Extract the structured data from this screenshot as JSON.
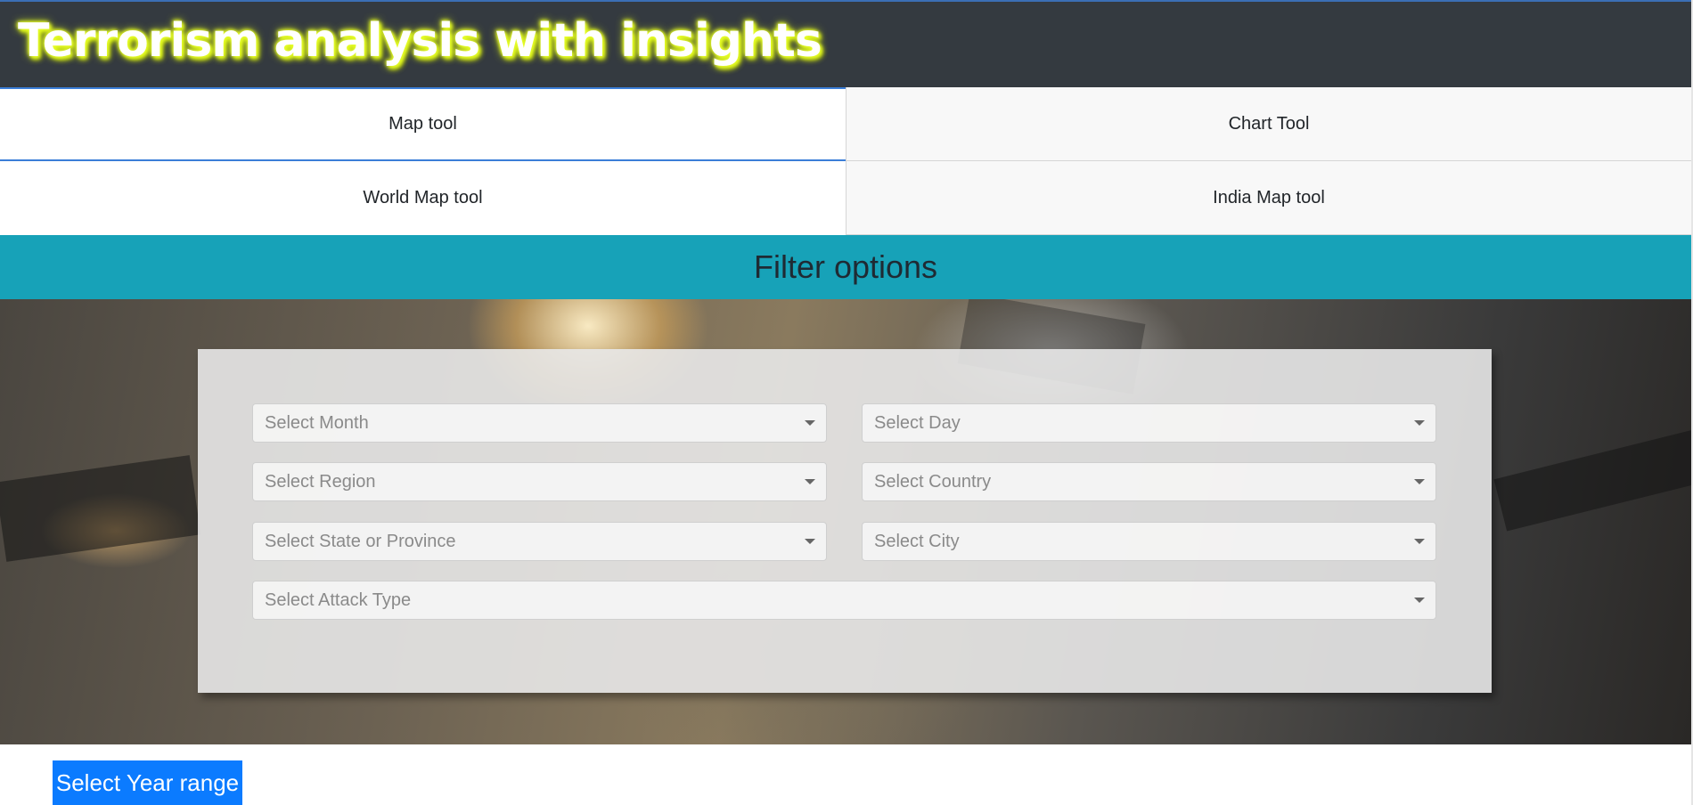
{
  "header": {
    "title": "Terrorism analysis with insights"
  },
  "tabs": [
    {
      "label": "Map tool",
      "state": "active"
    },
    {
      "label": "Chart Tool",
      "state": "inactive"
    },
    {
      "label": "World Map tool",
      "state": "active-subtab"
    },
    {
      "label": "India Map tool",
      "state": "inactive"
    }
  ],
  "filter": {
    "title": "Filter options",
    "dropdowns": [
      {
        "placeholder": "Select Month"
      },
      {
        "placeholder": "Select Day"
      },
      {
        "placeholder": "Select Region"
      },
      {
        "placeholder": "Select Country"
      },
      {
        "placeholder": "Select State or Province"
      },
      {
        "placeholder": "Select City"
      },
      {
        "placeholder": "Select Attack Type"
      }
    ]
  },
  "year_range": {
    "label": "Select Year range"
  },
  "colors": {
    "header": "#343a40",
    "filter_bar": "#17a2b8",
    "button": "#0b7bff",
    "title_glow": "#e8ff2a"
  }
}
